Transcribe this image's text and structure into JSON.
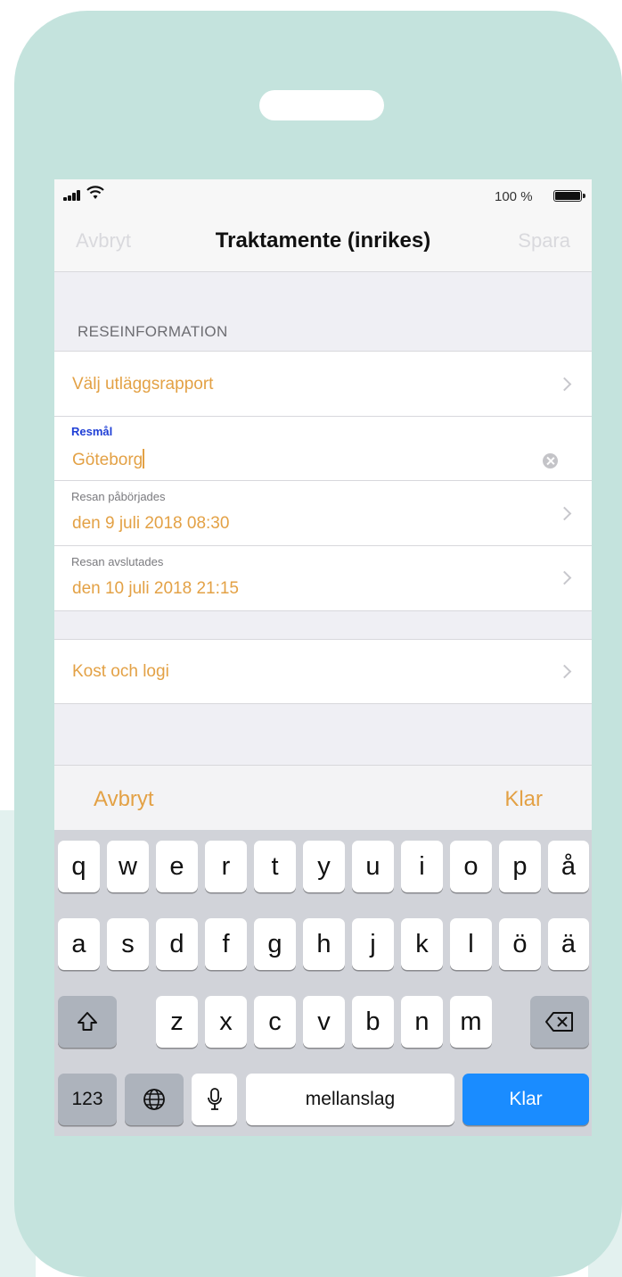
{
  "status_bar": {
    "battery_text": "100 %"
  },
  "nav": {
    "cancel": "Avbryt",
    "title": "Traktamente (inrikes)",
    "save": "Spara"
  },
  "section": {
    "header": "RESEINFORMATION"
  },
  "rows": {
    "expense_report": "Välj utläggsrapport",
    "destination": {
      "label": "Resmål",
      "value": "Göteborg"
    },
    "trip_start": {
      "label": "Resan påbörjades",
      "value": "den 9 juli 2018 08:30"
    },
    "trip_end": {
      "label": "Resan avslutades",
      "value": "den 10 juli 2018 21:15"
    },
    "board_lodging": "Kost och logi"
  },
  "toolbar": {
    "cancel": "Avbryt",
    "done": "Klar"
  },
  "keyboard": {
    "row1": [
      "q",
      "w",
      "e",
      "r",
      "t",
      "y",
      "u",
      "i",
      "o",
      "p",
      "å"
    ],
    "row2": [
      "a",
      "s",
      "d",
      "f",
      "g",
      "h",
      "j",
      "k",
      "l",
      "ö",
      "ä"
    ],
    "row3": [
      "z",
      "x",
      "c",
      "v",
      "b",
      "n",
      "m"
    ],
    "numbers": "123",
    "space": "mellanslag",
    "done": "Klar"
  },
  "colors": {
    "accent": "#e3a145",
    "active_label": "#1f3fd6",
    "phone_frame": "#c4e3dd",
    "keyboard_bg": "#d1d3d9",
    "return_key": "#1a8cff"
  }
}
